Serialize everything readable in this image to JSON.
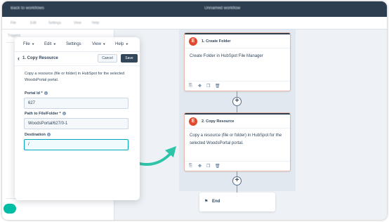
{
  "background_app": {
    "back_label": "Back to workflows",
    "workflow_title": "Unnamed workflow",
    "menu": [
      "File",
      "Edit",
      "Settings",
      "View",
      "Help"
    ],
    "sidebar_label": "Triggers"
  },
  "panel": {
    "menu": [
      {
        "label": "File"
      },
      {
        "label": "Edit"
      },
      {
        "label": "Settings"
      },
      {
        "label": "View"
      },
      {
        "label": "Help"
      }
    ],
    "title": "1. Copy Resource",
    "cancel_label": "Cancel",
    "save_label": "Save",
    "description": "Copy a resource (file or folder) in HubSpot for the selected WoodsPortal portal.",
    "fields": [
      {
        "label": "Portal Id *",
        "value": "627"
      },
      {
        "label": "Path to File/Folder *",
        "value": "WoodsPortal/627/0-1"
      },
      {
        "label": "Destination",
        "value": "/"
      }
    ]
  },
  "workflow": {
    "cards": [
      {
        "title": "1. Create Folder",
        "description": "Create Folder in HubSpot File Manager",
        "logo_letter": "E"
      },
      {
        "title": "2. Copy Resource",
        "description": "Copy a resource (file or folder) in HubSpot for the selected WoodsPortal portal.",
        "logo_letter": "E"
      }
    ],
    "add_symbol": "+",
    "end_label": "End",
    "end_flag": "⚑"
  },
  "colors": {
    "accent": "#00a4bd",
    "teal_arrow": "#2ec4a8",
    "card_border": "#e8b6a8",
    "logo_red": "#e2492f",
    "dark_header": "#2d3e50"
  },
  "icons": [
    "chevron-left-icon",
    "info-icon",
    "copy-icon",
    "move-icon",
    "clone-icon",
    "delete-icon",
    "add-icon",
    "flag-icon",
    "curved-arrow-icon"
  ]
}
